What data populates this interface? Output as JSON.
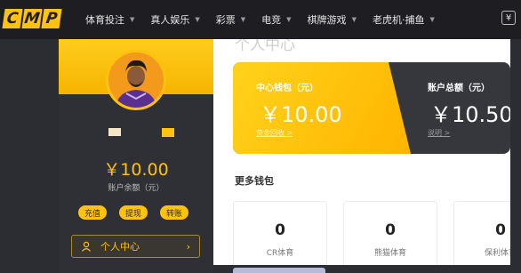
{
  "logo": {
    "letters": [
      "C",
      "M",
      "P"
    ]
  },
  "nav": {
    "items": [
      {
        "label": "体育投注"
      },
      {
        "label": "真人娱乐"
      },
      {
        "label": "彩票"
      },
      {
        "label": "电竞"
      },
      {
        "label": "棋牌游戏"
      },
      {
        "label": "老虎机·捕鱼"
      }
    ],
    "currency_icon": "¥"
  },
  "sidebar": {
    "balance": "￥10.00",
    "balance_label": "账户余额（元）",
    "buttons": [
      "充值",
      "提现",
      "转账"
    ],
    "personal_center": "个人中心"
  },
  "main": {
    "title": "个人中心",
    "center_wallet_label": "中心钱包（元）",
    "center_wallet_amount": "￥10.00",
    "center_wallet_link": "资金回收 >",
    "total_balance_label": "账户总额（元）",
    "total_balance_amount": "￥10.50",
    "total_balance_link": "说明 >",
    "more_wallets_title": "更多钱包",
    "wallets": [
      {
        "value": "0",
        "name": "CR体育"
      },
      {
        "value": "0",
        "name": "熊猫体育"
      },
      {
        "value": "0",
        "name": "保利体育"
      }
    ]
  },
  "colors": {
    "accent": "#ffc20e",
    "dark": "#2f2f36",
    "topbar": "#1e1e22"
  }
}
